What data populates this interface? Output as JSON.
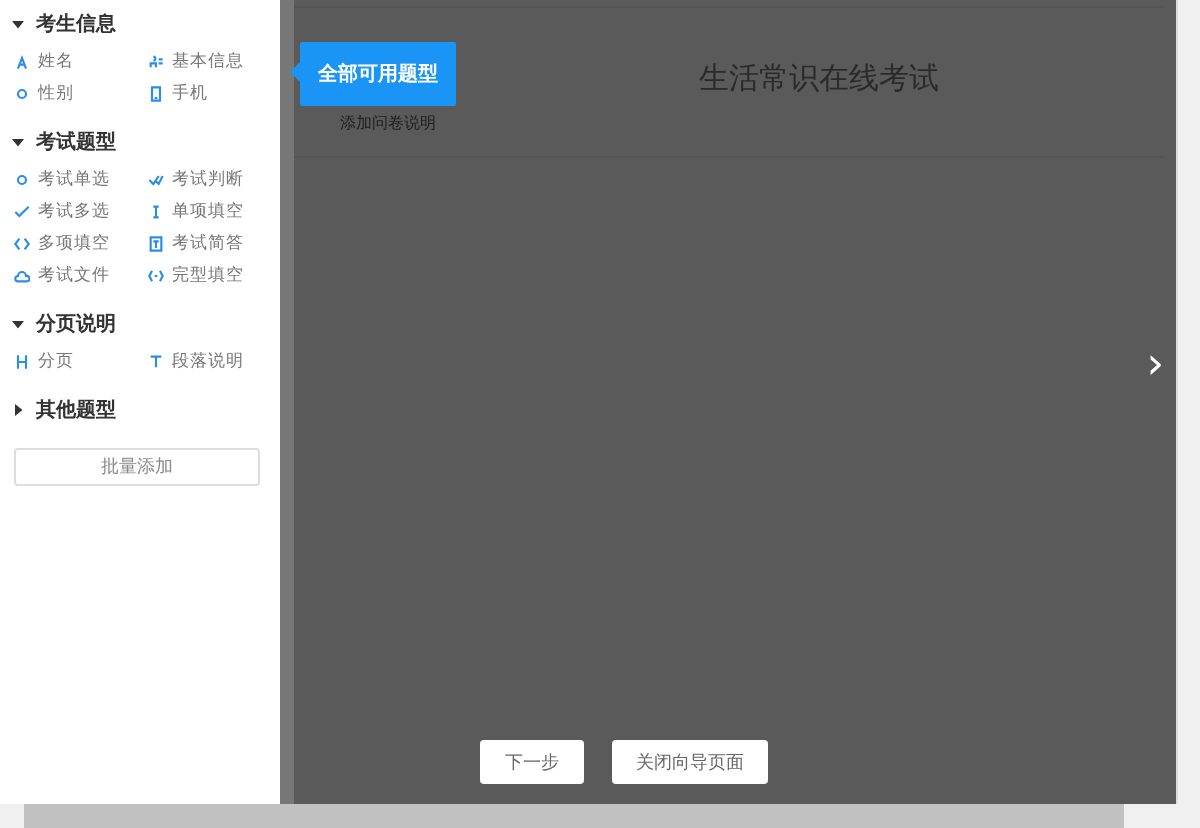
{
  "sidebar": {
    "sections": [
      {
        "title": "考生信息",
        "expanded": true,
        "items": [
          {
            "label": "姓名"
          },
          {
            "label": "基本信息"
          },
          {
            "label": "性别"
          },
          {
            "label": "手机"
          }
        ]
      },
      {
        "title": "考试题型",
        "expanded": true,
        "items": [
          {
            "label": "考试单选"
          },
          {
            "label": "考试判断"
          },
          {
            "label": "考试多选"
          },
          {
            "label": "单项填空"
          },
          {
            "label": "多项填空"
          },
          {
            "label": "考试简答"
          },
          {
            "label": "考试文件"
          },
          {
            "label": "完型填空"
          }
        ]
      },
      {
        "title": "分页说明",
        "expanded": true,
        "items": [
          {
            "label": "分页"
          },
          {
            "label": "段落说明"
          }
        ]
      },
      {
        "title": "其他题型",
        "expanded": false
      }
    ],
    "batch_button": "批量添加"
  },
  "tooltip": "全部可用题型",
  "survey": {
    "title": "生活常识在线考试",
    "description_link": "添加问卷说明"
  },
  "next_arrow": "›",
  "buttons": [
    {
      "label": "下一步"
    },
    {
      "label": "关闭向导页面"
    }
  ]
}
